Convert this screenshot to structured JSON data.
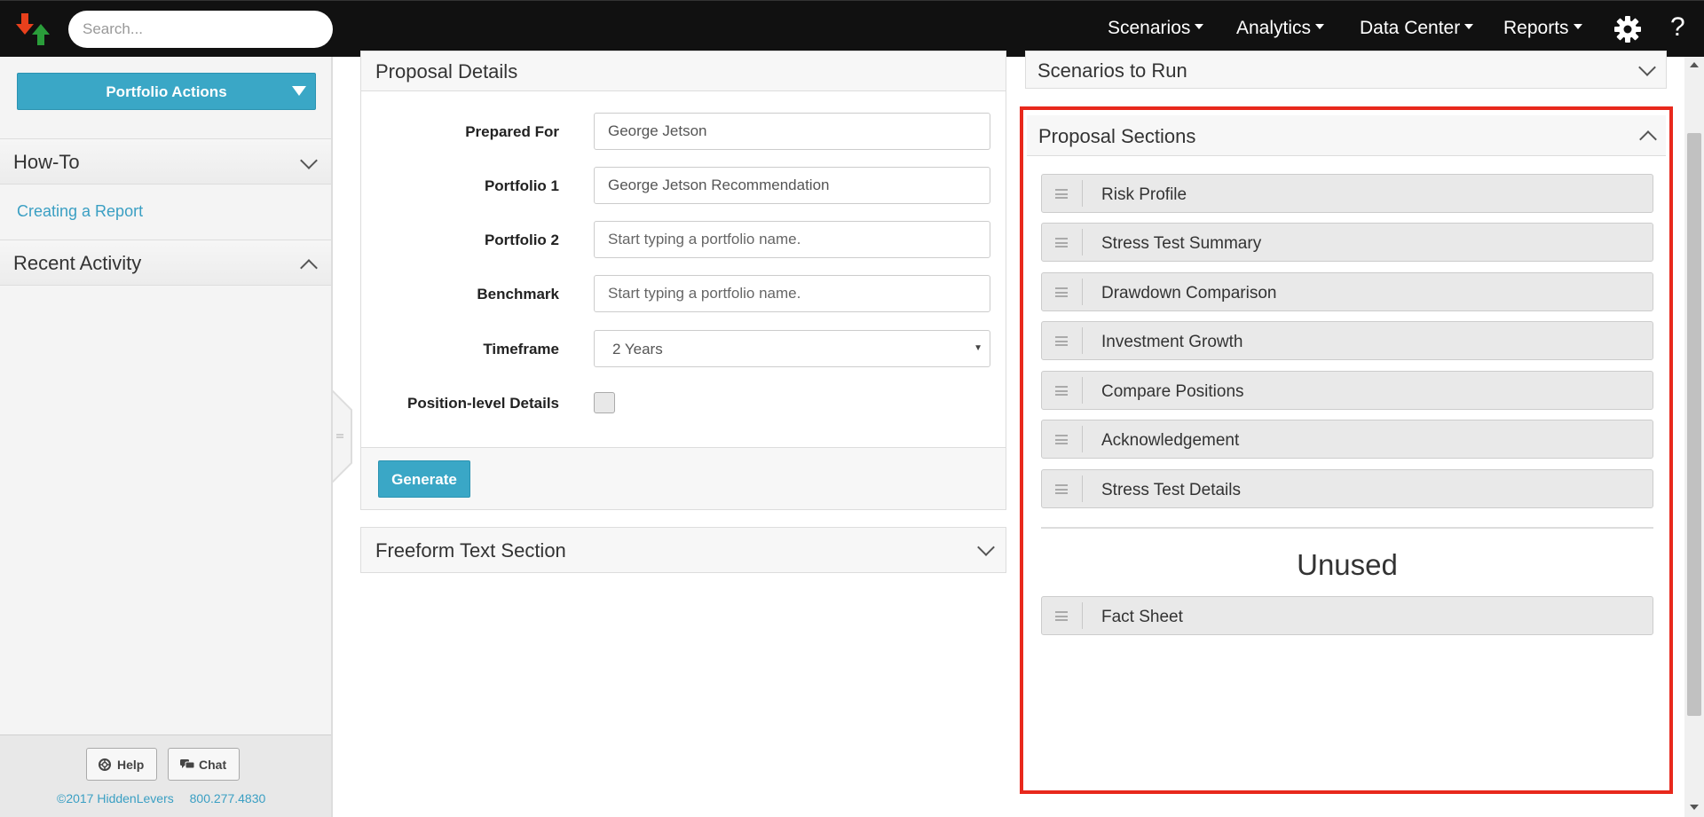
{
  "topbar": {
    "search_placeholder": "Search...",
    "nav": [
      "Scenarios",
      "Analytics",
      "Data Center",
      "Reports"
    ],
    "help_glyph": "?",
    "icons": {
      "settings": "gear-icon",
      "help": "question-icon",
      "logo": "hiddenlevers-logo"
    }
  },
  "sidebar": {
    "portfolio_actions": "Portfolio Actions",
    "howto": {
      "title": "How-To",
      "link": "Creating a Report"
    },
    "recent": {
      "title": "Recent Activity"
    },
    "footer": {
      "help": "Help",
      "chat": "Chat",
      "copyright": "©2017 HiddenLevers",
      "phone": "800.277.4830"
    }
  },
  "proposal_details": {
    "title": "Proposal Details",
    "fields": [
      {
        "label": "Prepared For",
        "value": "George Jetson",
        "placeholder": ""
      },
      {
        "label": "Portfolio 1",
        "value": "George Jetson Recommendation",
        "placeholder": ""
      },
      {
        "label": "Portfolio 2",
        "value": "",
        "placeholder": "Start typing a portfolio name."
      },
      {
        "label": "Benchmark",
        "value": "",
        "placeholder": "Start typing a portfolio name."
      }
    ],
    "timeframe": {
      "label": "Timeframe",
      "value": "2 Years"
    },
    "position_details": {
      "label": "Position-level Details",
      "checked": false
    },
    "generate": "Generate"
  },
  "freeform": {
    "title": "Freeform Text Section"
  },
  "scenarios_to_run": {
    "title": "Scenarios to Run"
  },
  "proposal_sections": {
    "title": "Proposal Sections",
    "used": [
      "Risk Profile",
      "Stress Test Summary",
      "Drawdown Comparison",
      "Investment Growth",
      "Compare Positions",
      "Acknowledgement",
      "Stress Test Details"
    ],
    "unused_title": "Unused",
    "unused": [
      "Fact Sheet"
    ]
  },
  "colors": {
    "accent": "#3aa7c6",
    "highlight": "#e8281c",
    "topbar": "#111111",
    "link": "#3a9fc3"
  }
}
